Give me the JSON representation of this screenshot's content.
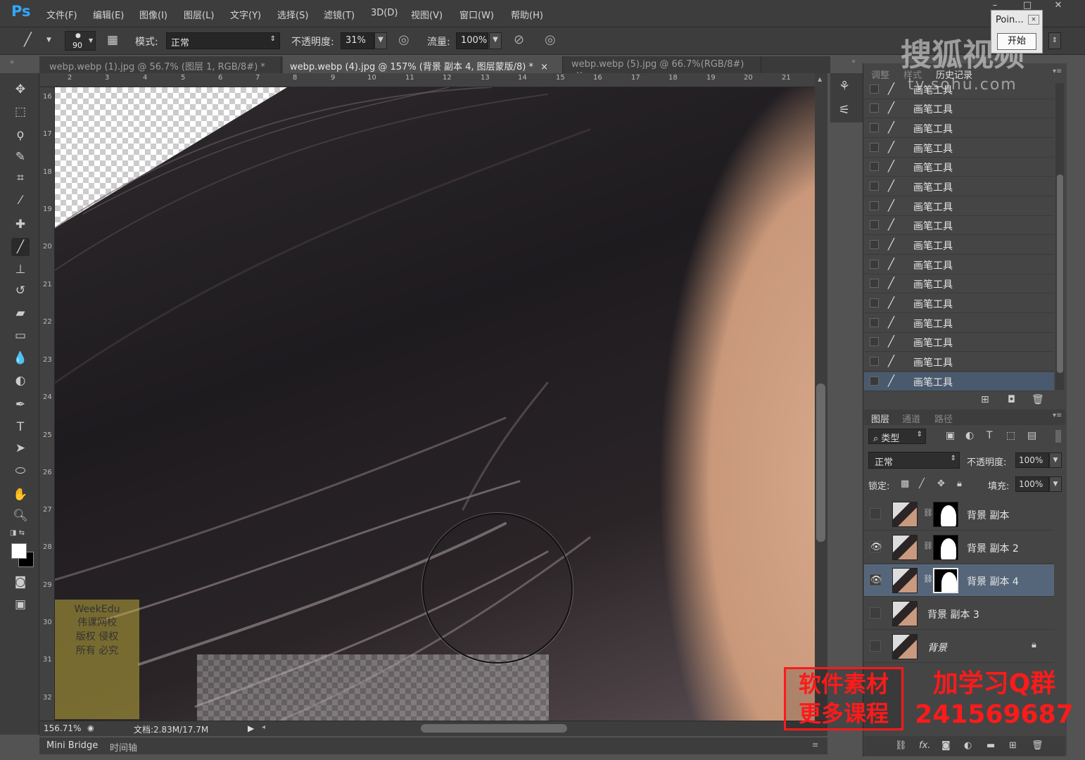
{
  "app": {
    "logo": "Ps"
  },
  "menu": [
    "文件(F)",
    "编辑(E)",
    "图像(I)",
    "图层(L)",
    "文字(Y)",
    "选择(S)",
    "滤镜(T)",
    "3D(D)",
    "视图(V)",
    "窗口(W)",
    "帮助(H)"
  ],
  "options": {
    "brush_size": "90",
    "mode_label": "模式:",
    "mode_value": "正常",
    "opacity_label": "不透明度:",
    "opacity_value": "31%",
    "flow_label": "流量:",
    "flow_value": "100%"
  },
  "tabs": [
    {
      "label": "webp.webp (1).jpg @ 56.7% (图层 1, RGB/8#) *",
      "close": "×"
    },
    {
      "label": "webp.webp (4).jpg @ 157% (背景 副本 4, 图层蒙版/8) *",
      "close": "×"
    },
    {
      "label": "webp.webp (5).jpg @ 66.7%(RGB/8#)",
      "close": "×"
    }
  ],
  "ruler_h": [
    "2",
    "3",
    "4",
    "5",
    "6",
    "7",
    "8",
    "9",
    "10",
    "11",
    "12",
    "13",
    "14",
    "15",
    "16",
    "17",
    "18",
    "19",
    "20",
    "21"
  ],
  "ruler_v": [
    "16",
    "17",
    "18",
    "19",
    "20",
    "21",
    "22",
    "23",
    "24",
    "25",
    "26",
    "27",
    "28",
    "29",
    "30",
    "31",
    "32"
  ],
  "status": {
    "zoom": "156.71%",
    "doc": "文档:2.83M/17.7M"
  },
  "bottom_tabs": [
    "Mini Bridge",
    "时间轴"
  ],
  "panel_tabs_top": [
    "调整",
    "样式",
    "历史记录"
  ],
  "history": [
    "画笔工具",
    "画笔工具",
    "画笔工具",
    "画笔工具",
    "画笔工具",
    "画笔工具",
    "画笔工具",
    "画笔工具",
    "画笔工具",
    "画笔工具",
    "画笔工具",
    "画笔工具",
    "画笔工具",
    "画笔工具",
    "画笔工具",
    "画笔工具"
  ],
  "panel_tabs_layers": [
    "图层",
    "通道",
    "路径"
  ],
  "layers_ctrl": {
    "kind": "类型",
    "blend": "正常",
    "opacity_label": "不透明度:",
    "opacity_value": "100%",
    "lock_label": "锁定:",
    "fill_label": "填充:",
    "fill_value": "100%"
  },
  "layers": [
    {
      "name": "背景 副本",
      "visible": false,
      "mask": true
    },
    {
      "name": "背景 副本 2",
      "visible": true,
      "mask": true
    },
    {
      "name": "背景 副本 4",
      "visible": true,
      "mask": true,
      "active": true
    },
    {
      "name": "背景 副本 3",
      "visible": false,
      "mask": false
    },
    {
      "name": "背景",
      "visible": false,
      "mask": false,
      "locked": true
    }
  ],
  "overlay": {
    "poin": "Poin...",
    "start": "开始",
    "watermark": "搜狐视频",
    "watermark_url": "tv.sohu.com",
    "promo_left": "软件素材\n更多课程",
    "promo_right": "加学习Q群\n241569687",
    "weekedu": "WeekEdu\n伟课网校\n版权 侵权\n所有 必究"
  }
}
